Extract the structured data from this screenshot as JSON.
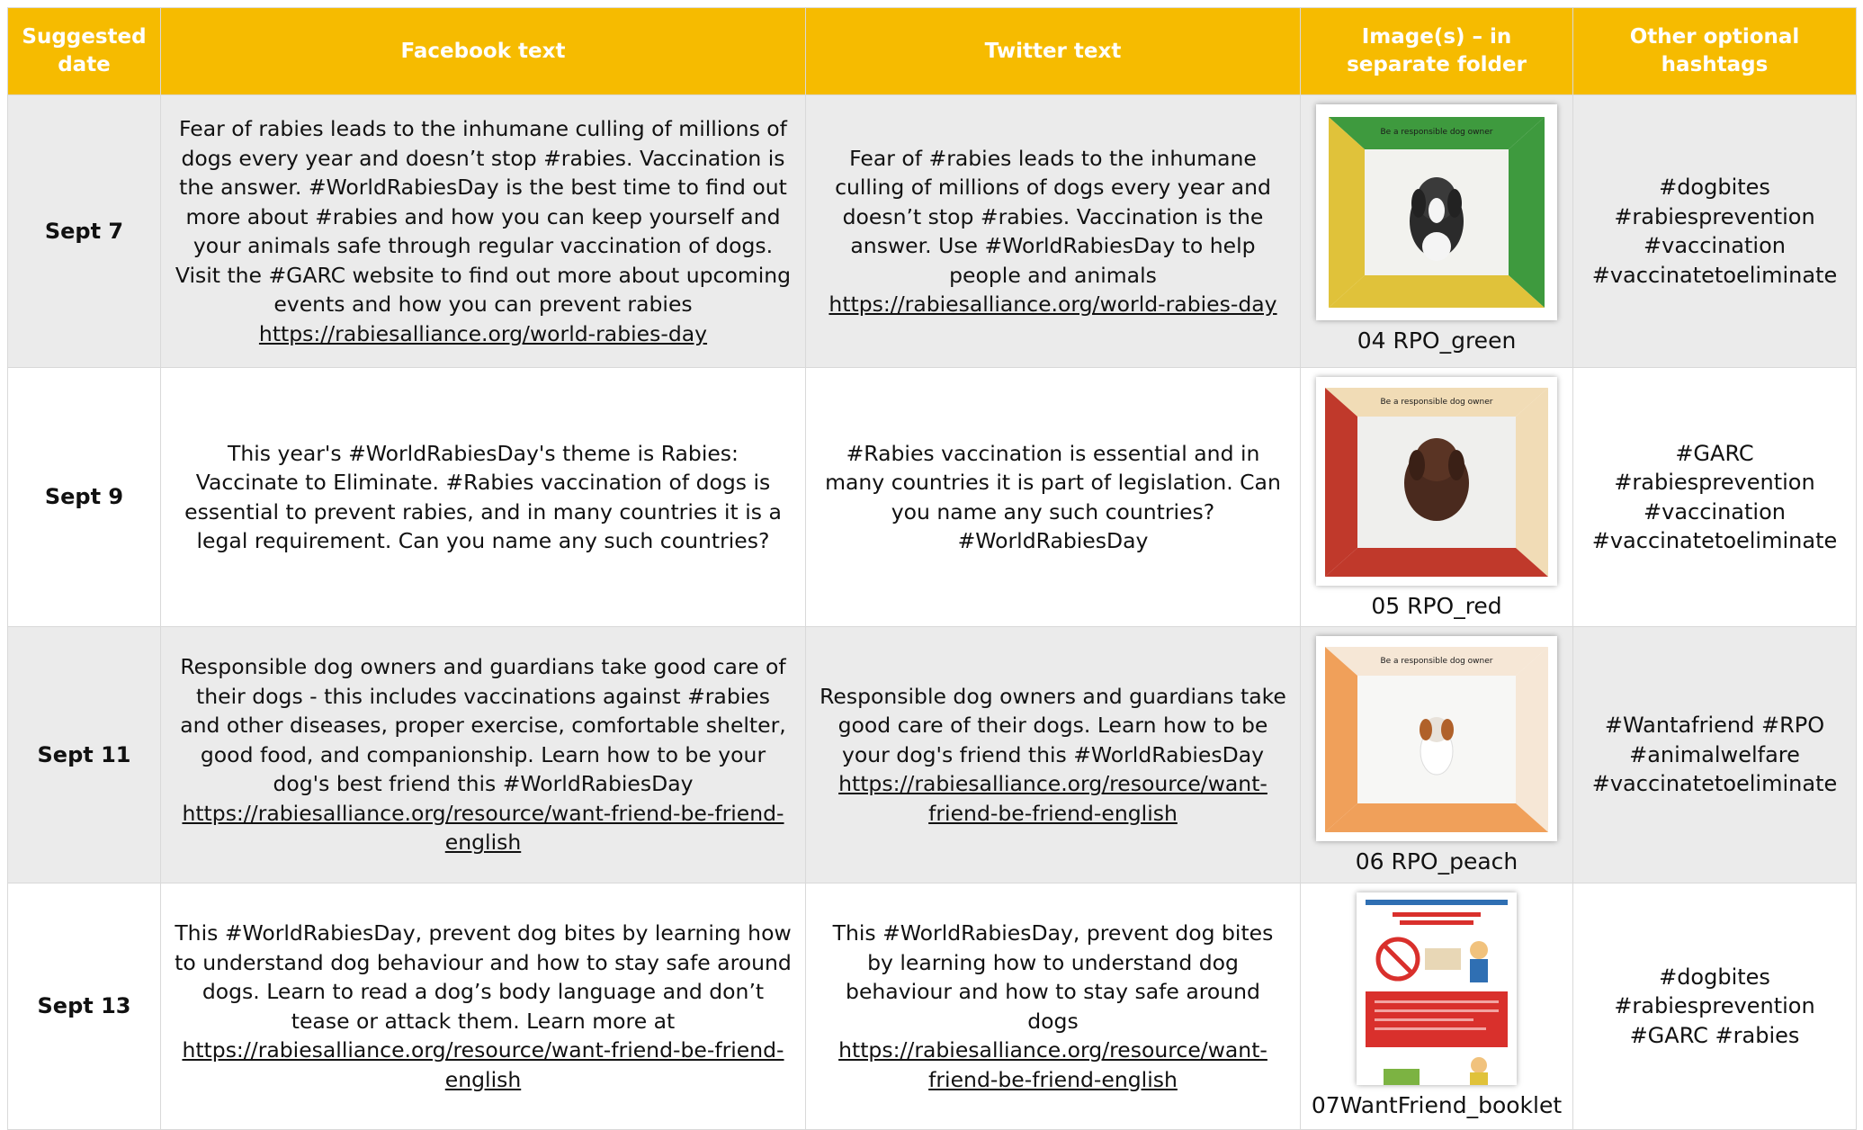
{
  "headers": {
    "date": "Suggested date",
    "facebook": "Facebook text",
    "twitter": "Twitter text",
    "images": "Image(s) – in separate folder",
    "hashtags": "Other optional hashtags"
  },
  "rows": [
    {
      "date": "Sept 7",
      "facebook_text": "Fear of rabies leads to the inhumane culling of millions of dogs every year and doesn’t stop #rabies. Vaccination is the answer. #WorldRabiesDay is the best time to find out more about #rabies and how you can keep yourself and your animals safe through regular vaccination of dogs. Visit the #GARC website to find out more about upcoming events and how you can prevent rabies ",
      "facebook_link": "https://rabiesalliance.org/world-rabies-day",
      "twitter_text": "Fear of #rabies leads to the inhumane culling of millions of dogs every year and doesn’t stop #rabies. Vaccination is the answer. Use #WorldRabiesDay to help people and animals ",
      "twitter_link": "https://rabiesalliance.org/world-rabies-day",
      "image_caption": "04 RPO_green",
      "image_color": "#3e9a3e",
      "image_accent": "#e0c23a",
      "hashtags": [
        "#dogbites",
        "#rabiesprevention",
        "#vaccination",
        "#vaccinatetoeliminate"
      ]
    },
    {
      "date": "Sept 9",
      "facebook_text": "This year's #WorldRabiesDay's theme is Rabies: Vaccinate to Eliminate. #Rabies vaccination of dogs is essential to prevent rabies, and in many countries it is a legal requirement. Can you name any such countries?",
      "facebook_link": "",
      "twitter_text": "#Rabies vaccination is essential and in many countries it is part of legislation. Can you name any such countries? #WorldRabiesDay",
      "twitter_link": "",
      "image_caption": "05 RPO_red",
      "image_color": "#c0392b",
      "image_accent": "#f1dcb6",
      "hashtags": [
        "#GARC",
        "#rabiesprevention",
        "#vaccination",
        "#vaccinatetoeliminate"
      ]
    },
    {
      "date": "Sept 11",
      "facebook_text": "Responsible dog owners and guardians take good care of their dogs - this includes vaccinations against #rabies and other diseases, proper exercise, comfortable shelter, good food, and companionship. Learn how to be your dog's best friend this #WorldRabiesDay  ",
      "facebook_link": "https://rabiesalliance.org/resource/want-friend-be-friend-english",
      "twitter_text": "Responsible dog owners and guardians take good care of their dogs. Learn how to be your dog's friend this #WorldRabiesDay ",
      "twitter_link": "https://rabiesalliance.org/resource/want-friend-be-friend-english",
      "image_caption": "06 RPO_peach",
      "image_color": "#f0a05a",
      "image_accent": "#f6d9b8",
      "hashtags": [
        "#Wantafriend #RPO",
        "#animalwelfare",
        "#vaccinatetoeliminate"
      ]
    },
    {
      "date": "Sept 13",
      "facebook_text": "This #WorldRabiesDay, prevent dog bites by learning how to understand dog behaviour and how to stay safe around dogs. Learn to read a dog’s body language and don’t tease or attack them. Learn more at ",
      "facebook_link": "https://rabiesalliance.org/resource/want-friend-be-friend-english",
      "twitter_text": "This #WorldRabiesDay, prevent dog bites by learning how to understand dog behaviour and how to stay safe around dogs ",
      "twitter_link": "https://rabiesalliance.org/resource/want-friend-be-friend-english",
      "image_caption": "07WantFriend_booklet",
      "image_color": "#d9302c",
      "image_accent": "#2f6fb3",
      "hashtags": [
        "#dogbites",
        "#rabiesprevention",
        "#GARC #rabies"
      ]
    }
  ]
}
